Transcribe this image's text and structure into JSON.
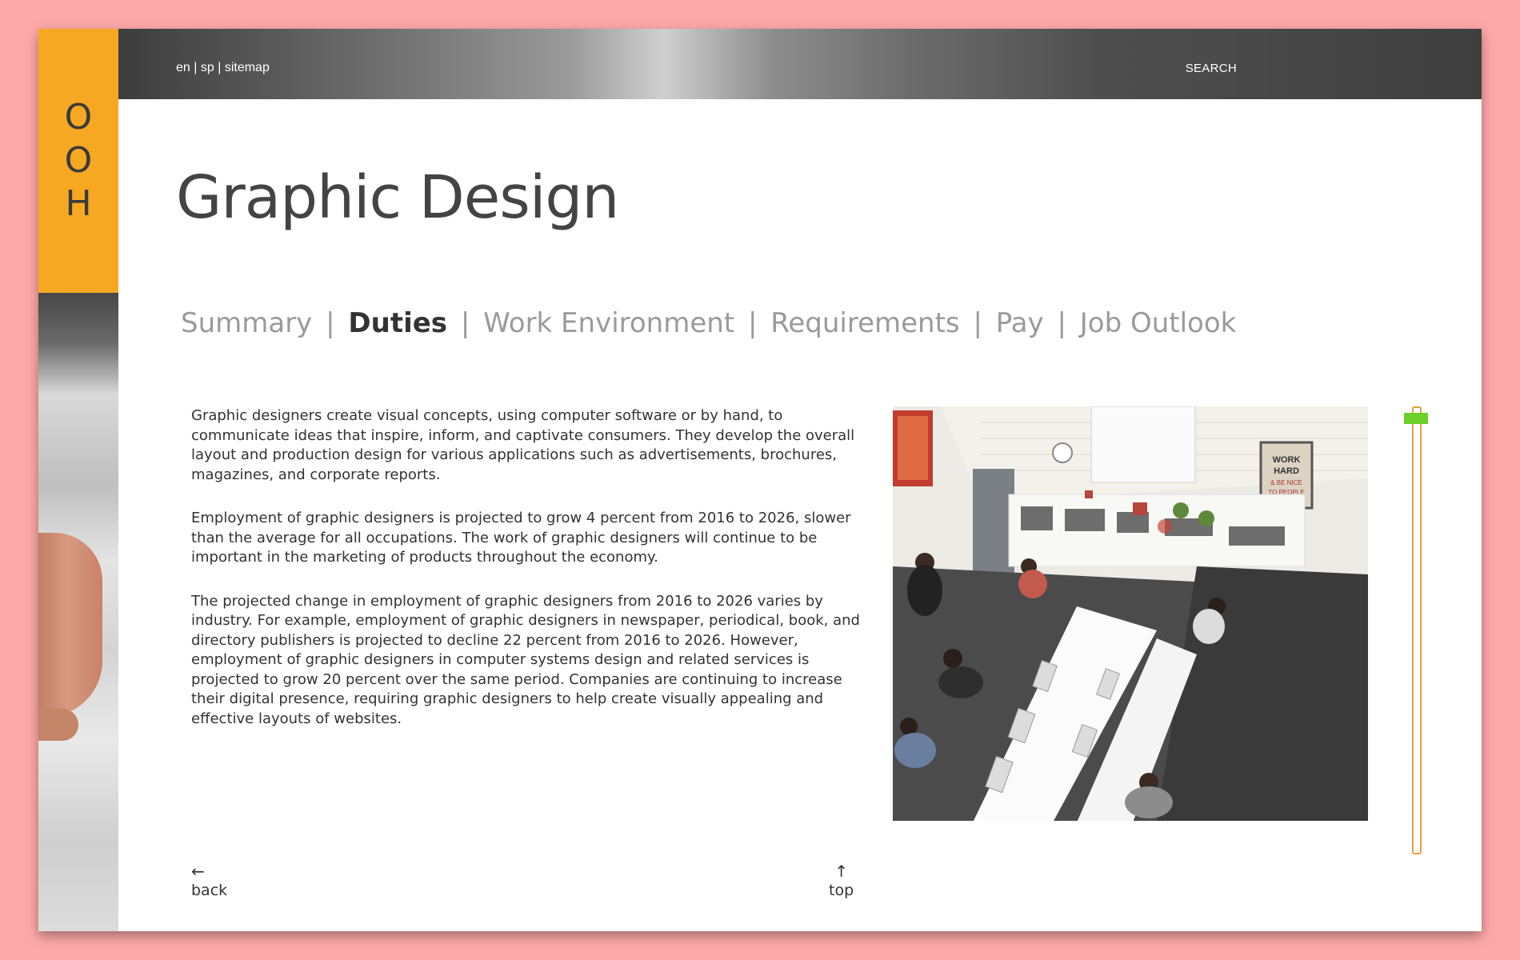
{
  "logo": {
    "letters": [
      "O",
      "O",
      "H"
    ]
  },
  "topbar": {
    "lang_en": "en",
    "lang_sp": "sp",
    "sitemap": "sitemap",
    "separator": "|",
    "search_label": "SEARCH"
  },
  "page_title": "Graphic Design",
  "tabs": [
    {
      "label": "Summary",
      "active": false
    },
    {
      "label": "Duties",
      "active": true
    },
    {
      "label": "Work Environment",
      "active": false
    },
    {
      "label": "Requirements",
      "active": false
    },
    {
      "label": "Pay",
      "active": false
    },
    {
      "label": "Job Outlook",
      "active": false
    }
  ],
  "tab_separator": "|",
  "paragraphs": [
    "Graphic designers create visual concepts, using computer software or by hand, to communicate ideas that inspire, inform, and captivate consumers. They develop the overall layout and production design for various applications such as advertisements, brochures, magazines, and corporate reports.",
    "Employment of graphic designers is projected to grow 4 percent from 2016 to 2026, slower than the average for all occupations. The work of graphic designers will continue to be important in the marketing of products throughout the economy.",
    "The projected change in employment of graphic designers from 2016 to 2026 varies by industry. For example, employment of graphic designers in newspaper, periodical, book, and directory publishers is projected to decline 22 percent from 2016 to 2026. However, employment of graphic designers in computer systems design and related services is projected to grow 20 percent over the same period. Companies are continuing to increase their digital presence, requiring graphic designers to help create visually appealing and effective layouts of websites."
  ],
  "office_poster_text": "WORK HARD & BE NICE TO PEOPLE",
  "footer": {
    "back_arrow": "←",
    "back_label": "back",
    "top_arrow": "↑",
    "top_label": "top"
  },
  "colors": {
    "background": "#fda8a8",
    "logo_block": "#f7a823",
    "scroll_rail": "#e8a23a",
    "scroll_thumb": "#6ccf2a",
    "active_tab": "#333333",
    "inactive_tab": "#9a9a9a"
  }
}
